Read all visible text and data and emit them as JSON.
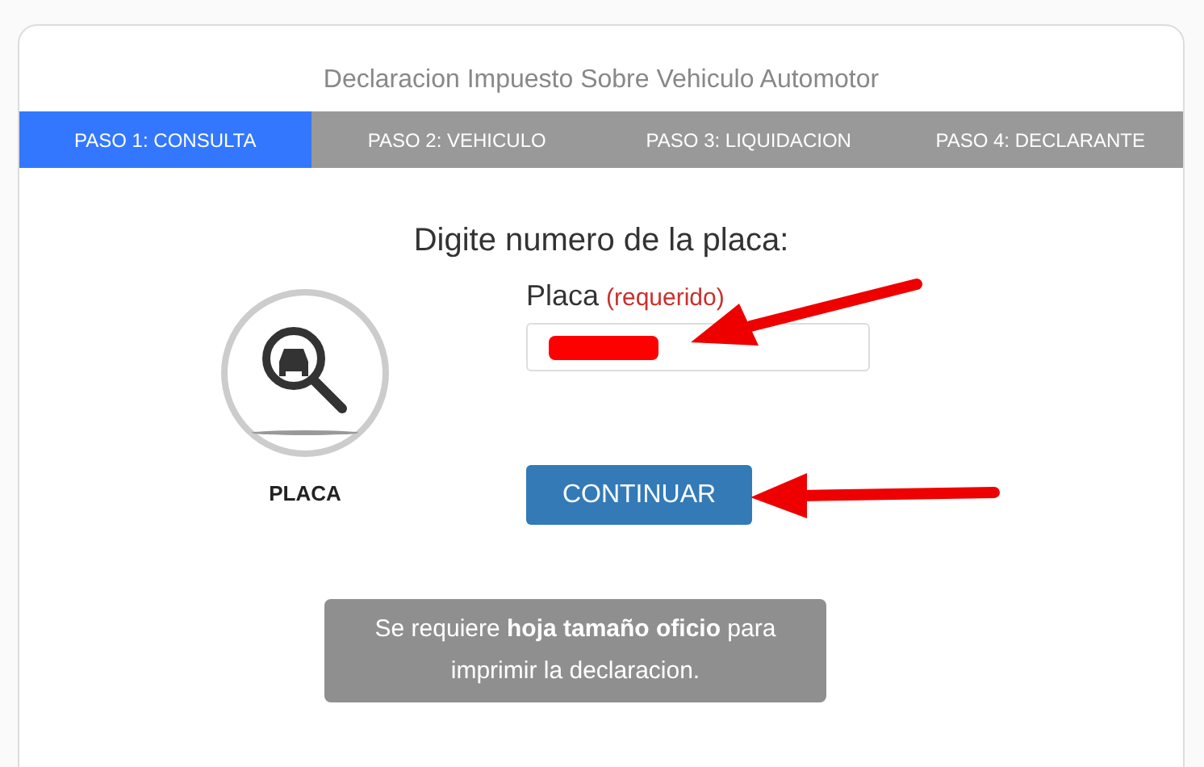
{
  "title": "Declaracion Impuesto Sobre Vehiculo Automotor",
  "tabs": [
    {
      "label": "PASO 1: CONSULTA",
      "selected": true
    },
    {
      "label": "PASO 2: VEHICULO",
      "selected": false
    },
    {
      "label": "PASO 3: LIQUIDACION",
      "selected": false
    },
    {
      "label": "PASO 4: DECLARANTE",
      "selected": false
    }
  ],
  "heading": "Digite numero de la placa:",
  "icon_caption": "PLACA",
  "field": {
    "label": "Placa",
    "required_note": "(requerido)",
    "redacted": true
  },
  "button": "CONTINUAR",
  "note": "Se requiere **hoja tamaño oficio** para imprimir la declaracion."
}
